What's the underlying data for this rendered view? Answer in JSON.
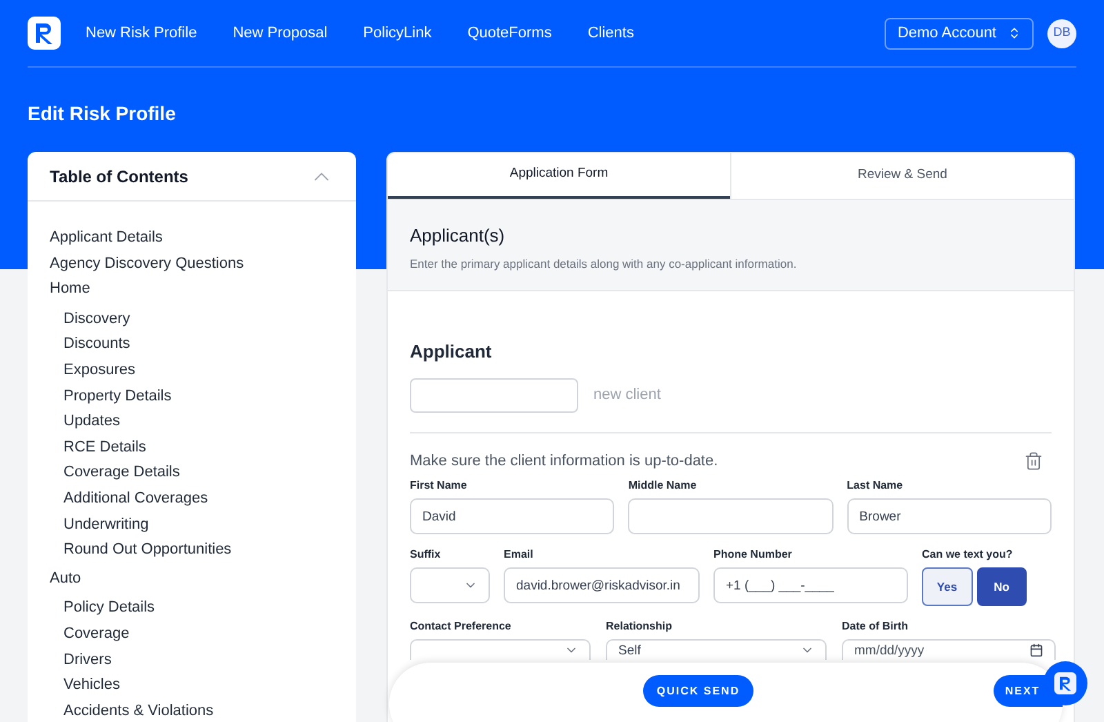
{
  "nav": {
    "links": [
      "New Risk Profile",
      "New Proposal",
      "PolicyLink",
      "QuoteForms",
      "Clients"
    ],
    "account": "Demo Account",
    "avatar": "DB"
  },
  "page_title": "Edit Risk Profile",
  "toc": {
    "title": "Table of Contents",
    "expanded": true,
    "items": [
      {
        "label": "Applicant Details"
      },
      {
        "label": "Agency Discovery Questions"
      },
      {
        "label": "Home",
        "children": [
          {
            "label": "Discovery"
          },
          {
            "label": "Discounts"
          },
          {
            "label": "Exposures"
          },
          {
            "label": "Property Details"
          },
          {
            "label": "Updates"
          },
          {
            "label": "RCE Details"
          },
          {
            "label": "Coverage Details"
          },
          {
            "label": "Additional Coverages"
          },
          {
            "label": "Underwriting"
          },
          {
            "label": "Round Out Opportunities"
          }
        ]
      },
      {
        "label": "Auto",
        "children": [
          {
            "label": "Policy Details"
          },
          {
            "label": "Coverage"
          },
          {
            "label": "Drivers"
          },
          {
            "label": "Vehicles"
          },
          {
            "label": "Accidents & Violations"
          }
        ]
      }
    ]
  },
  "tabs": [
    {
      "label": "Application Form",
      "selected": true
    },
    {
      "label": "Review & Send",
      "selected": false
    }
  ],
  "section": {
    "title": "Applicant(s)",
    "subtitle": "Enter the primary applicant details along with any co-applicant information."
  },
  "applicant": {
    "heading": "Applicant",
    "hint": "new client",
    "notice": "Make sure the client information is up-to-date.",
    "rows": [
      [
        {
          "kind": "text",
          "label": "First Name",
          "value": "David"
        },
        {
          "kind": "text",
          "label": "Middle Name"
        },
        {
          "kind": "text",
          "label": "Last Name",
          "value": "Brower"
        }
      ],
      [
        {
          "kind": "select",
          "label": "Suffix"
        },
        {
          "kind": "text",
          "label": "Email",
          "value": "david.brower@riskadvisor.in"
        },
        {
          "kind": "text",
          "label": "Phone Number",
          "value": "+1 (___) ___-____"
        },
        {
          "kind": "toggle",
          "label": "Can we text you?",
          "options": [
            {
              "label": "Yes",
              "selected": false
            },
            {
              "label": "No",
              "selected": true
            }
          ]
        }
      ],
      [
        {
          "kind": "select",
          "label": "Contact Preference"
        },
        {
          "kind": "select",
          "label": "Relationship",
          "value": "Self"
        },
        {
          "kind": "date",
          "label": "Date of Birth",
          "placeholder": "mm/dd/yyyy"
        }
      ]
    ]
  },
  "footer": {
    "quick_send": "QUICK SEND",
    "next": "NEXT"
  }
}
